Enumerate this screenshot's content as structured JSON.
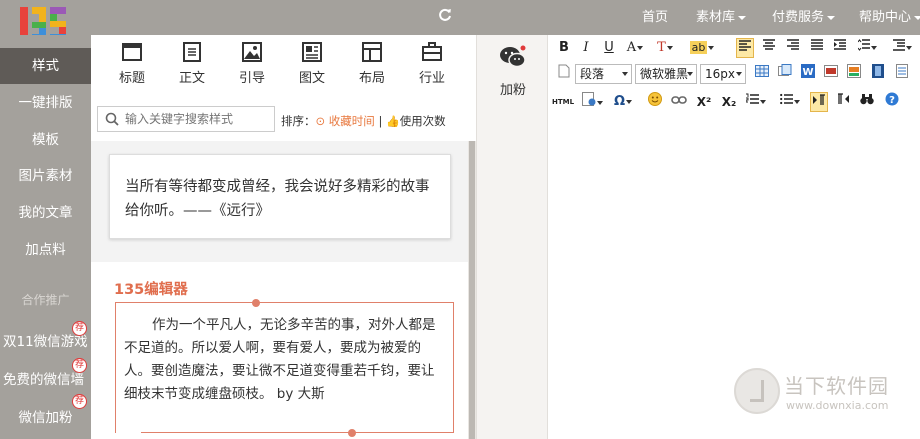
{
  "topnav": {
    "home": "首页",
    "materials": "素材库",
    "paid": "付费服务",
    "help": "帮助中心"
  },
  "sidebar": {
    "items": [
      "样式",
      "一键排版",
      "模板",
      "图片素材",
      "我的文章",
      "加点料"
    ],
    "section": "合作推广",
    "promos": [
      {
        "label": "双11微信游戏",
        "badge": "荐"
      },
      {
        "label": "免费的微信墙",
        "badge": "荐"
      },
      {
        "label": "微信加粉",
        "badge": "荐"
      }
    ]
  },
  "categories": [
    "标题",
    "正文",
    "引导",
    "图文",
    "布局",
    "行业"
  ],
  "search": {
    "placeholder": "输入关键字搜索样式"
  },
  "sort": {
    "label": "排序：",
    "option1": "收藏时间",
    "separator": "|",
    "option2": "使用次数"
  },
  "cards": {
    "quote": "当所有等待都变成曾经，我会说好多精彩的故事给你听。——《远行》",
    "title": "135编辑器",
    "body": "作为一个平凡人，无论多辛苦的事，对外人都是不足道的。所以爱人啊，要有爱人，要成为被爱的人。要创造魔法，要让微不足道变得重若千钧，要让细枝末节变成缠盘硕枝。 by 大斯"
  },
  "addfans": {
    "label": "加粉"
  },
  "toolbar": {
    "bold": "B",
    "italic": "I",
    "underline": "U",
    "fontcolor": "A",
    "bgcolor": "T",
    "paragraph": "段落",
    "font": "微软雅黑",
    "fontsize": "16px",
    "html": "HTML",
    "omega": "Ω",
    "sup": "X²",
    "sub": "X₂"
  },
  "watermark": {
    "name": "当下软件园",
    "url": "www.downxia.com"
  },
  "colors": {
    "chrome": "#a4a19c",
    "sidebar_active": "#5f5b57",
    "accent": "#e06e4e",
    "sort_active": "#e8793f"
  }
}
